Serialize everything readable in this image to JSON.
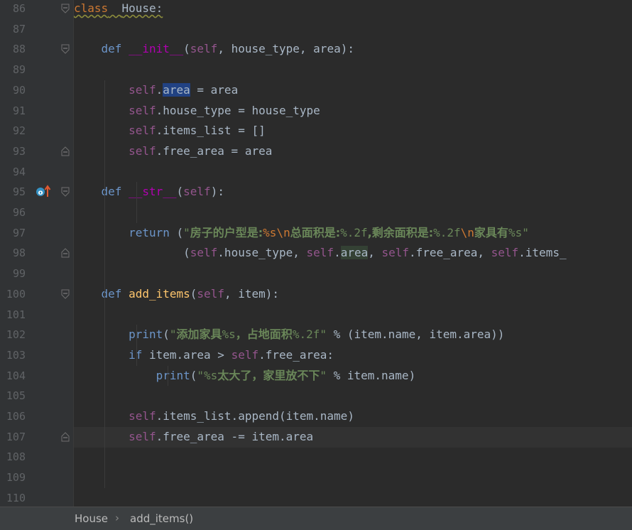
{
  "editor": {
    "line_numbers": [
      "86",
      "87",
      "88",
      "89",
      "90",
      "91",
      "92",
      "93",
      "94",
      "95",
      "96",
      "97",
      "98",
      "99",
      "100",
      "101",
      "102",
      "103",
      "104",
      "105",
      "106",
      "107",
      "108",
      "109",
      "110"
    ],
    "lines": [
      {
        "n": "86",
        "segs": [
          [
            "kw",
            "class"
          ],
          [
            "",
            "  "
          ],
          [
            "",
            "House:"
          ]
        ]
      },
      {
        "n": "87",
        "segs": []
      },
      {
        "n": "88",
        "segs": [
          [
            "",
            "    "
          ],
          [
            "kwb",
            "def"
          ],
          [
            "",
            " "
          ],
          [
            "dunder",
            "__init__"
          ],
          [
            "",
            "("
          ],
          [
            "self",
            "self"
          ],
          [
            "",
            ", house_type, area):"
          ]
        ]
      },
      {
        "n": "89",
        "segs": []
      },
      {
        "n": "90",
        "segs": [
          [
            "",
            "        "
          ],
          [
            "self",
            "self"
          ],
          [
            "",
            "."
          ],
          [
            "sel",
            "area"
          ],
          [
            "",
            " = area"
          ]
        ]
      },
      {
        "n": "91",
        "segs": [
          [
            "",
            "        "
          ],
          [
            "self",
            "self"
          ],
          [
            "",
            ".house_type = house_type"
          ]
        ]
      },
      {
        "n": "92",
        "segs": [
          [
            "",
            "        "
          ],
          [
            "self",
            "self"
          ],
          [
            "",
            ".items_list = []"
          ]
        ]
      },
      {
        "n": "93",
        "segs": [
          [
            "",
            "        "
          ],
          [
            "self",
            "self"
          ],
          [
            "",
            ".free_area = area"
          ]
        ]
      },
      {
        "n": "94",
        "segs": []
      },
      {
        "n": "95",
        "segs": [
          [
            "",
            "    "
          ],
          [
            "kwb",
            "def"
          ],
          [
            "",
            " "
          ],
          [
            "dunder",
            "__str__"
          ],
          [
            "",
            "("
          ],
          [
            "self",
            "self"
          ],
          [
            "",
            "):"
          ]
        ]
      },
      {
        "n": "96",
        "segs": []
      },
      {
        "n": "97",
        "segs": [
          [
            "",
            "        "
          ],
          [
            "kwb",
            "return"
          ],
          [
            "",
            " ("
          ],
          [
            "str",
            "\""
          ],
          [
            "strcn",
            "房子的户型是:"
          ],
          [
            "fmt",
            "%s\\n"
          ],
          [
            "strcn",
            "总面积是:"
          ],
          [
            "str",
            "%.2f"
          ],
          [
            "strcn",
            ",剩余面积是:"
          ],
          [
            "str",
            "%.2f"
          ],
          [
            "fmt",
            "\\n"
          ],
          [
            "strcn",
            "家具有"
          ],
          [
            "str",
            "%s\""
          ]
        ]
      },
      {
        "n": "98",
        "segs": [
          [
            "",
            "                ("
          ],
          [
            "self",
            "self"
          ],
          [
            "",
            ".house_type, "
          ],
          [
            "self",
            "self"
          ],
          [
            "",
            "."
          ],
          [
            "sel2",
            "area"
          ],
          [
            "",
            ", "
          ],
          [
            "self",
            "self"
          ],
          [
            "",
            ".free_area, "
          ],
          [
            "self",
            "self"
          ],
          [
            "",
            ".items_"
          ]
        ]
      },
      {
        "n": "99",
        "segs": []
      },
      {
        "n": "100",
        "segs": [
          [
            "",
            "    "
          ],
          [
            "kwb",
            "def"
          ],
          [
            "",
            " "
          ],
          [
            "fn",
            "add_items"
          ],
          [
            "",
            "("
          ],
          [
            "self",
            "self"
          ],
          [
            "",
            ", item):"
          ]
        ]
      },
      {
        "n": "101",
        "segs": []
      },
      {
        "n": "102",
        "segs": [
          [
            "",
            "        "
          ],
          [
            "kwb",
            "print"
          ],
          [
            "",
            "("
          ],
          [
            "str",
            "\""
          ],
          [
            "strcn",
            "添加家具"
          ],
          [
            "str",
            "%s"
          ],
          [
            "strcn",
            "，占地面积"
          ],
          [
            "str",
            "%.2f\""
          ],
          [
            "",
            " % (item.name, item.area))"
          ]
        ]
      },
      {
        "n": "103",
        "segs": [
          [
            "",
            "        "
          ],
          [
            "kwb",
            "if"
          ],
          [
            "",
            " item.area > "
          ],
          [
            "self",
            "self"
          ],
          [
            "",
            ".free_area:"
          ]
        ]
      },
      {
        "n": "104",
        "segs": [
          [
            "",
            "            "
          ],
          [
            "kwb",
            "print"
          ],
          [
            "",
            "("
          ],
          [
            "str",
            "\"%s"
          ],
          [
            "strcn",
            "太大了，家里放不下"
          ],
          [
            "str",
            "\""
          ],
          [
            "",
            " % item.name)"
          ]
        ]
      },
      {
        "n": "105",
        "segs": []
      },
      {
        "n": "106",
        "segs": [
          [
            "",
            "        "
          ],
          [
            "self",
            "self"
          ],
          [
            "",
            ".items_list.append(item.name)"
          ]
        ]
      },
      {
        "n": "107",
        "segs": [
          [
            "",
            "        "
          ],
          [
            "self",
            "self"
          ],
          [
            "",
            ".free_area -= item.area"
          ]
        ]
      },
      {
        "n": "108",
        "segs": []
      },
      {
        "n": "109",
        "segs": []
      },
      {
        "n": "110",
        "segs": []
      }
    ],
    "current_line": "107"
  },
  "breadcrumb": {
    "class_name": "House",
    "separator": "›",
    "method_name": "add_items()"
  },
  "icons": {
    "override_marker": "override-method-icon",
    "fold_marker": "fold-marker-icon"
  },
  "colors": {
    "background": "#2b2b2b",
    "keyword": "#cc7832",
    "self": "#94558d",
    "string": "#6a8759",
    "function": "#ffc66d",
    "text": "#a9b7c6"
  }
}
